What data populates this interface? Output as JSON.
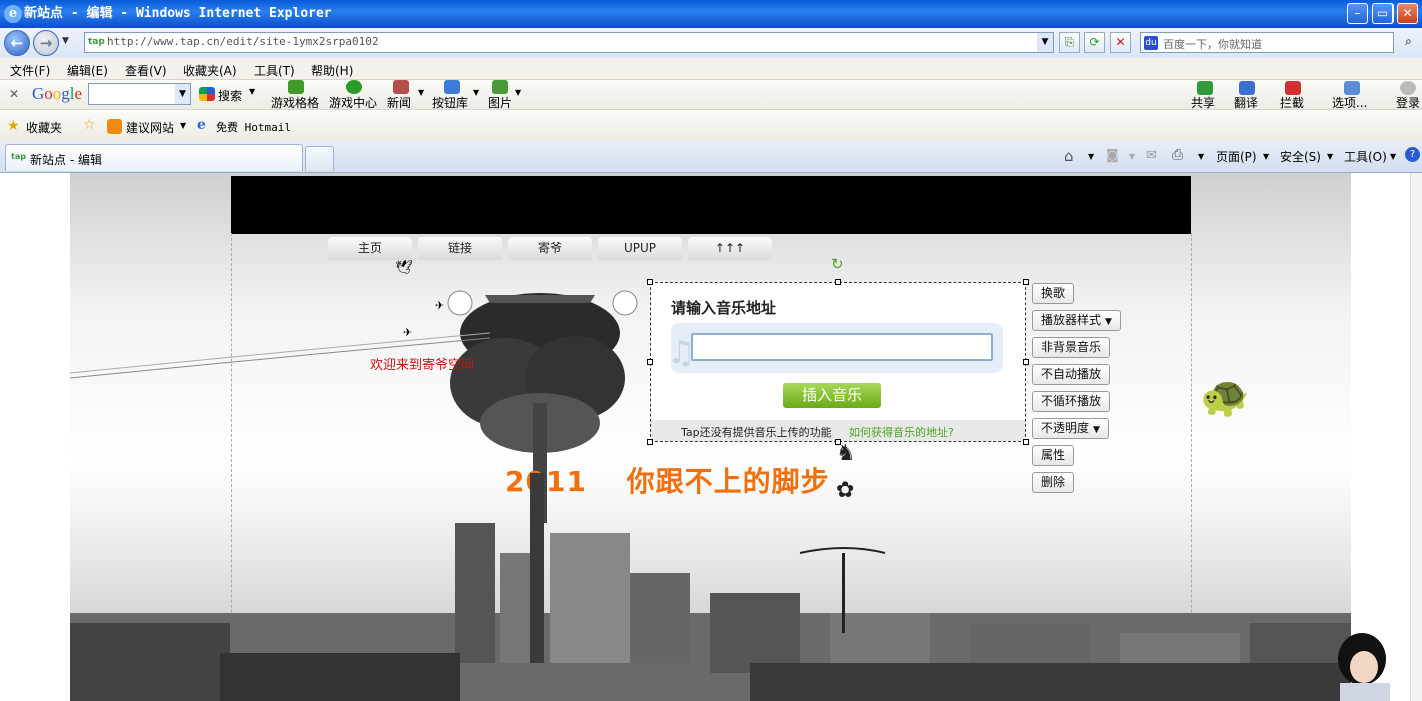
{
  "window": {
    "title": "新站点 - 编辑 - Windows Internet Explorer"
  },
  "address": {
    "url": "http://www.tap.cn/edit/site-1ymx2srpa0102",
    "search_placeholder": "百度一下，你就知道"
  },
  "menu": [
    "文件(F)",
    "编辑(E)",
    "查看(V)",
    "收藏夹(A)",
    "工具(T)",
    "帮助(H)"
  ],
  "google_toolbar": {
    "brand": "Google",
    "search_label": "搜索",
    "items": [
      "游戏格格",
      "游戏中心",
      "新闻",
      "按钮库",
      "图片"
    ],
    "right_items": [
      "共享",
      "翻译",
      "拦截",
      "选项...",
      "登录"
    ]
  },
  "favorites": {
    "label": "收藏夹",
    "items": [
      "建议网站",
      "免费 Hotmail"
    ]
  },
  "tab": {
    "title": "新站点 - 编辑"
  },
  "command_bar": {
    "page": "页面(P)",
    "safety": "安全(S)",
    "tools": "工具(O)"
  },
  "site": {
    "nav": [
      "主页",
      "链接",
      "寄爷",
      "UPUP",
      "↑↑↑"
    ],
    "welcome": "欢迎来到寄爷空间",
    "slogan": "2011　 你跟不上的脚步"
  },
  "music_dialog": {
    "heading": "请输入音乐地址",
    "input_value": "",
    "insert_button": "插入音乐",
    "note": "Tap还没有提供音乐上传的功能",
    "help_link": "如何获得音乐的地址?"
  },
  "side_buttons": [
    "换歌",
    "播放器样式",
    "非背景音乐",
    "不自动播放",
    "不循环播放",
    "不透明度",
    "属性",
    "删除"
  ],
  "colors": {
    "titlebar": "#0a5ad8",
    "slogan": "#f07010",
    "welcome": "#d01010",
    "insert_button": "#6aaa18",
    "help_link": "#4aa520"
  }
}
